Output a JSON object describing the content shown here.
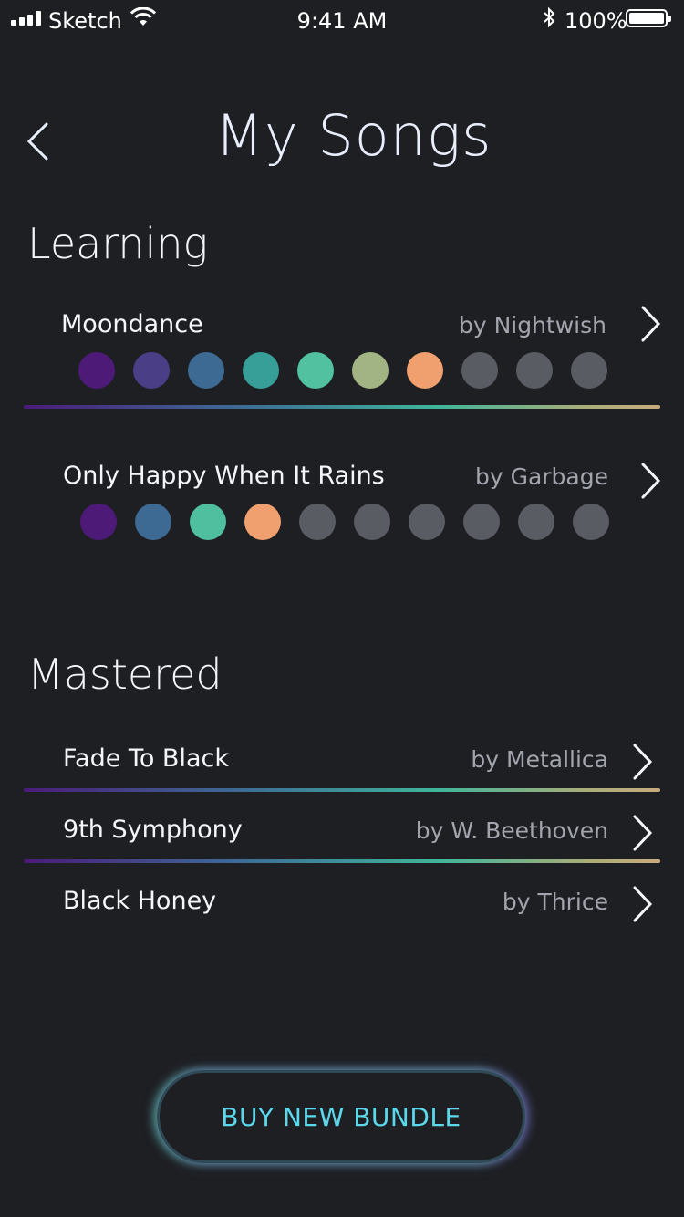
{
  "status_bar": {
    "carrier": "Sketch",
    "time": "9:41 AM",
    "battery_percent": "100%"
  },
  "header": {
    "title": "My Songs",
    "back_icon": "chevron-left-icon"
  },
  "sections": {
    "learning": {
      "title": "Learning",
      "songs": [
        {
          "name": "Moondance",
          "artist": "by Nightwish",
          "progress_dots": [
            "#4d1a78",
            "#4a3f86",
            "#3d6a92",
            "#379e98",
            "#52c1a0",
            "#a2b484",
            "#f0a06e",
            "#595c63",
            "#595c63",
            "#595c63"
          ]
        },
        {
          "name": "Only Happy When It Rains",
          "artist": "by Garbage",
          "progress_dots": [
            "#4d1a78",
            "#3d6a92",
            "#4fbf9f",
            "#f0a06e",
            "#595c63",
            "#595c63",
            "#595c63",
            "#595c63",
            "#595c63",
            "#595c63"
          ]
        }
      ]
    },
    "mastered": {
      "title": "Mastered",
      "songs": [
        {
          "name": "Fade To Black",
          "artist": "by Metallica"
        },
        {
          "name": "9th Symphony",
          "artist": "by W. Beethoven"
        },
        {
          "name": "Black Honey",
          "artist": "by Thrice"
        }
      ]
    }
  },
  "buy_button": {
    "label": "BUY NEW BUNDLE"
  },
  "colors": {
    "background": "#1e1f23",
    "accent_text": "#5ad8ec",
    "dot_inactive": "#595c63",
    "gradient": [
      "#4a1b79",
      "#3d6e96",
      "#3fb59a",
      "#c8ab7d"
    ]
  }
}
